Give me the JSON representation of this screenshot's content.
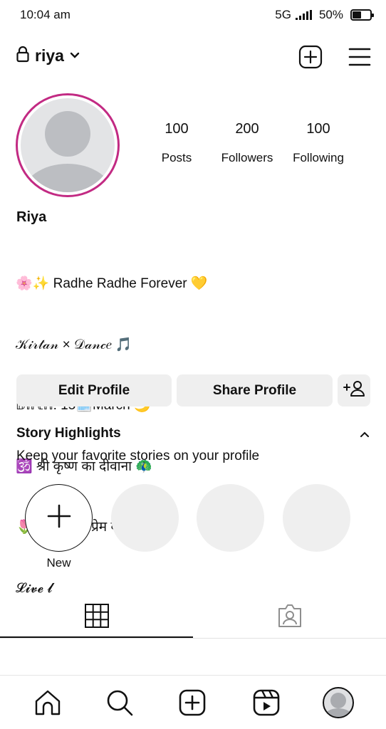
{
  "status_bar": {
    "time": "10:04 am",
    "network": "5G",
    "battery": "50%",
    "battery_level": 0.5
  },
  "header": {
    "username": "riya",
    "icons": [
      "lock-icon",
      "chevron-down-icon",
      "create-post-icon",
      "menu-icon"
    ]
  },
  "profile": {
    "display_name": "Riya",
    "stats": [
      {
        "value": "100",
        "label": "Posts"
      },
      {
        "value": "200",
        "label": "Followers"
      },
      {
        "value": "100",
        "label": "Following"
      }
    ],
    "bio_lines": [
      "🌸✨ Radhe Radhe Forever 💛",
      "𝒦𝒾𝓇𝓉𝒶𝓃 × 𝒟𝒶𝓃𝒸𝑒 🎵",
      "𝔹𝕚𝕣𝕥𝕙: 15🗓️March 🌙",
      "🕉️ श्री कृष्ण का दीवाना 🦚",
      "🌷 भक्ति और प्रेम की राह ❤️",
      "𝓛𝓲𝓿𝓮 𝓵"
    ]
  },
  "actions": {
    "edit_profile": "Edit Profile",
    "share_profile": "Share Profile"
  },
  "highlights": {
    "title": "Story Highlights",
    "subtitle": "Keep your favorite stories on your profile",
    "new_label": "New",
    "placeholder_count": 3
  },
  "tabs": [
    "grid-icon",
    "tagged-icon"
  ],
  "bottom_nav": [
    "home-icon",
    "search-icon",
    "create-icon",
    "reels-icon",
    "profile-avatar"
  ],
  "colors": {
    "story_ring": "#c22a83",
    "button_bg": "#efefef"
  }
}
